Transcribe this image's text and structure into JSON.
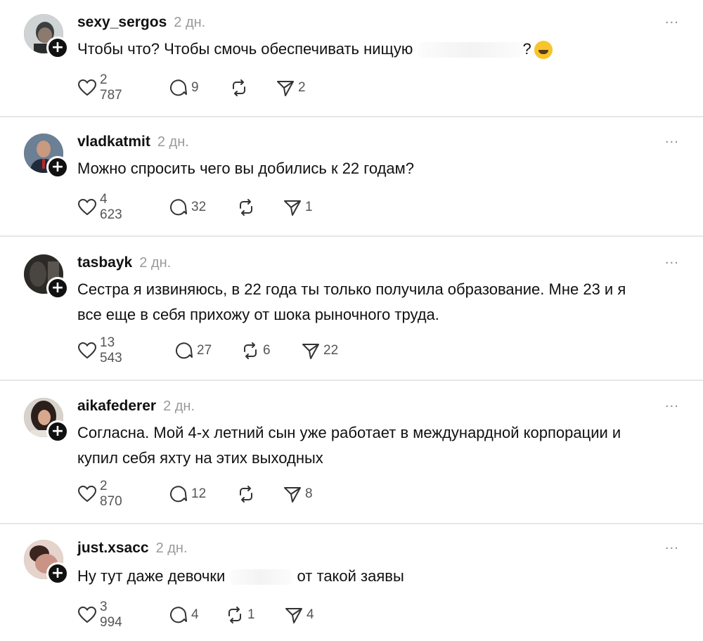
{
  "posts": [
    {
      "username": "sexy_sergos",
      "time": "2 дн.",
      "text_parts": [
        "Чтобы что? Чтобы смочь обеспечивать нищую",
        "?"
      ],
      "likes": "2 787",
      "replies": "9",
      "reposts": "",
      "shares": "2",
      "avatar_color": "#2e3a3e"
    },
    {
      "username": "vladkatmit",
      "time": "2 дн.",
      "text": "Можно спросить чего вы добились к 22 годам?",
      "likes": "4 623",
      "replies": "32",
      "reposts": "",
      "shares": "1",
      "avatar_color": "#3b4c6b"
    },
    {
      "username": "tasbayk",
      "time": "2 дн.",
      "text_lines": [
        "Сестра я извиняюсь, в 22 года ты только получила образование. Мне 23 и я",
        "все еще в себя прихожу от шока рыночного труда."
      ],
      "likes": "13 543",
      "replies": "27",
      "reposts": "6",
      "shares": "22",
      "avatar_color": "#3a3530"
    },
    {
      "username": "aikafederer",
      "time": "2 дн.",
      "text_lines": [
        "Согласна. Мой 4-х летний сын уже работает в междунардной корпорации и",
        "купил себя яхту на этих выходных"
      ],
      "likes": "2 870",
      "replies": "12",
      "reposts": "",
      "shares": "8",
      "avatar_color": "#4a3a35"
    },
    {
      "username": "just.xsacc",
      "time": "2 дн.",
      "text_parts": [
        "Ну тут даже девочки",
        "от такой заявы"
      ],
      "likes": "3 994",
      "replies": "4",
      "reposts": "1",
      "shares": "4",
      "avatar_color": "#c9a08f"
    }
  ],
  "ui": {
    "more": "···",
    "follow": "+"
  }
}
